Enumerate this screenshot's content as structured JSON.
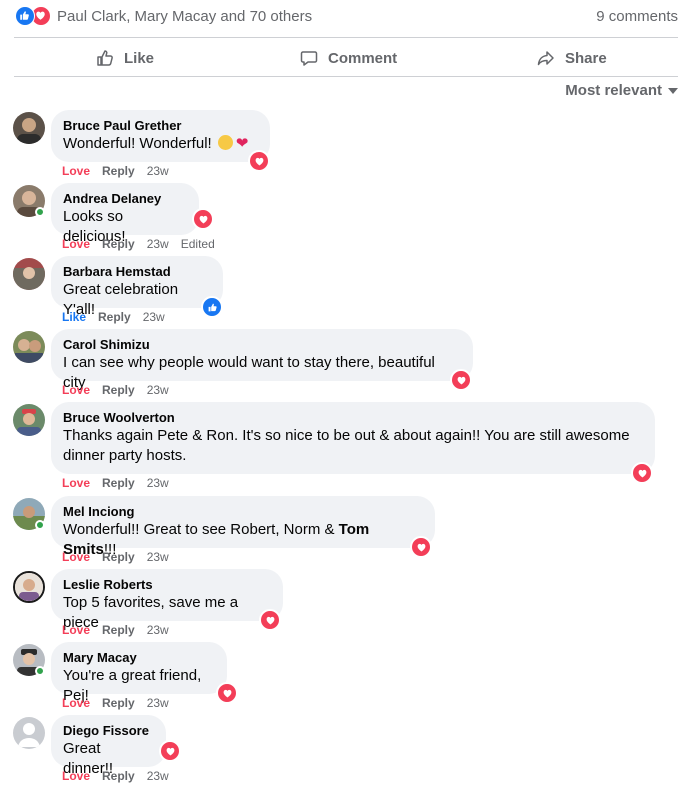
{
  "summary": {
    "names": "Paul Clark, Mary Macay and 70 others",
    "comments_count": "9 comments"
  },
  "actions": {
    "like": "Like",
    "comment": "Comment",
    "share": "Share"
  },
  "sort_label": "Most relevant",
  "colors": {
    "love": "#f33e58",
    "like": "#1877f2",
    "gray": "#65676b",
    "bubble": "#f0f2f5"
  },
  "comments": [
    {
      "author": "Bruce Paul Grether",
      "text": "Wonderful! Wonderful!",
      "reaction": "Love",
      "reply": "Reply",
      "time": "23w",
      "edited": ""
    },
    {
      "author": "Andrea Delaney",
      "text": "Looks so delicious!",
      "reaction": "Love",
      "reply": "Reply",
      "time": "23w",
      "edited": "Edited"
    },
    {
      "author": "Barbara Hemstad",
      "text": "Great celebration Y'all!",
      "reaction": "Like",
      "reply": "Reply",
      "time": "23w",
      "edited": ""
    },
    {
      "author": "Carol Shimizu",
      "text": "I can see why people would want to stay there, beautiful city",
      "reaction": "Love",
      "reply": "Reply",
      "time": "23w",
      "edited": ""
    },
    {
      "author": "Bruce Woolverton",
      "text": "Thanks again Pete & Ron. It's so nice to be out & about again!! You are still awesome dinner party hosts.",
      "reaction": "Love",
      "reply": "Reply",
      "time": "23w",
      "edited": ""
    },
    {
      "author": "Mel Inciong",
      "text": "Wonderful!! Great to see Robert, Norm & ",
      "mention": "Tom Smits",
      "text_after": "!!!",
      "reaction": "Love",
      "reply": "Reply",
      "time": "23w",
      "edited": ""
    },
    {
      "author": "Leslie Roberts",
      "text": "Top 5 favorites, save me a piece",
      "reaction": "Love",
      "reply": "Reply",
      "time": "23w",
      "edited": ""
    },
    {
      "author": "Mary Macay",
      "text": "You're a great friend, Pej!",
      "reaction": "Love",
      "reply": "Reply",
      "time": "23w",
      "edited": ""
    },
    {
      "author": "Diego Fissore",
      "text": "Great dinner!!",
      "reaction": "Love",
      "reply": "Reply",
      "time": "23w",
      "edited": ""
    }
  ]
}
